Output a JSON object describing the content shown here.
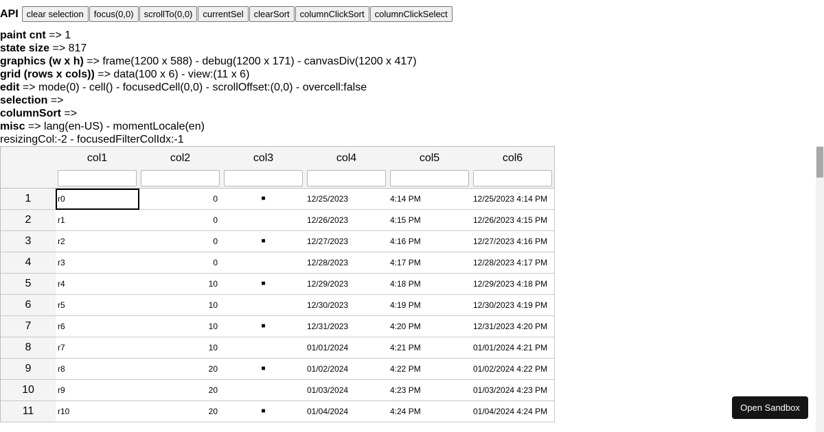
{
  "api": {
    "label": "API",
    "buttons": [
      "clear selection",
      "focus(0,0)",
      "scrollTo(0,0)",
      "currentSel",
      "clearSort",
      "columnClickSort",
      "columnClickSelect"
    ]
  },
  "debug": {
    "lines": [
      {
        "key": "paint cnt",
        "value": "=> 1"
      },
      {
        "key": "state size",
        "value": "=> 817"
      },
      {
        "key": "graphics (w x h)",
        "value": "=> frame(1200 x 588) - debug(1200 x 171) - canvasDiv(1200 x 417)"
      },
      {
        "key": "grid (rows x cols))",
        "value": "=> data(100 x 6) - view:(11 x 6)"
      },
      {
        "key": "edit",
        "value": "=> mode(0) - cell() - focusedCell(0,0) - scrollOffset:(0,0) - overcell:false"
      },
      {
        "key": "selection",
        "value": "=>"
      },
      {
        "key": "columnSort",
        "value": "=>"
      },
      {
        "key": "misc",
        "value": "=> lang(en-US) - momentLocale(en)"
      },
      {
        "key": "",
        "value": "resizingCol:-2 - focusedFilterColIdx:-1"
      }
    ]
  },
  "grid": {
    "columns": [
      "col1",
      "col2",
      "col3",
      "col4",
      "col5",
      "col6"
    ],
    "check_glyph": "■",
    "rows": [
      {
        "idx": "1",
        "c1": "r0",
        "c2": "0",
        "c3": true,
        "c4": "12/25/2023",
        "c5": "4:14 PM",
        "c6": "12/25/2023 4:14 PM"
      },
      {
        "idx": "2",
        "c1": "r1",
        "c2": "0",
        "c3": false,
        "c4": "12/26/2023",
        "c5": "4:15 PM",
        "c6": "12/26/2023 4:15 PM"
      },
      {
        "idx": "3",
        "c1": "r2",
        "c2": "0",
        "c3": true,
        "c4": "12/27/2023",
        "c5": "4:16 PM",
        "c6": "12/27/2023 4:16 PM"
      },
      {
        "idx": "4",
        "c1": "r3",
        "c2": "0",
        "c3": false,
        "c4": "12/28/2023",
        "c5": "4:17 PM",
        "c6": "12/28/2023 4:17 PM"
      },
      {
        "idx": "5",
        "c1": "r4",
        "c2": "10",
        "c3": true,
        "c4": "12/29/2023",
        "c5": "4:18 PM",
        "c6": "12/29/2023 4:18 PM"
      },
      {
        "idx": "6",
        "c1": "r5",
        "c2": "10",
        "c3": false,
        "c4": "12/30/2023",
        "c5": "4:19 PM",
        "c6": "12/30/2023 4:19 PM"
      },
      {
        "idx": "7",
        "c1": "r6",
        "c2": "10",
        "c3": true,
        "c4": "12/31/2023",
        "c5": "4:20 PM",
        "c6": "12/31/2023 4:20 PM"
      },
      {
        "idx": "8",
        "c1": "r7",
        "c2": "10",
        "c3": false,
        "c4": "01/01/2024",
        "c5": "4:21 PM",
        "c6": "01/01/2024 4:21 PM"
      },
      {
        "idx": "9",
        "c1": "r8",
        "c2": "20",
        "c3": true,
        "c4": "01/02/2024",
        "c5": "4:22 PM",
        "c6": "01/02/2024 4:22 PM"
      },
      {
        "idx": "10",
        "c1": "r9",
        "c2": "20",
        "c3": false,
        "c4": "01/03/2024",
        "c5": "4:23 PM",
        "c6": "01/03/2024 4:23 PM"
      },
      {
        "idx": "11",
        "c1": "r10",
        "c2": "20",
        "c3": true,
        "c4": "01/04/2024",
        "c5": "4:24 PM",
        "c6": "01/04/2024 4:24 PM"
      }
    ]
  },
  "sandbox": {
    "label": "Open Sandbox"
  }
}
